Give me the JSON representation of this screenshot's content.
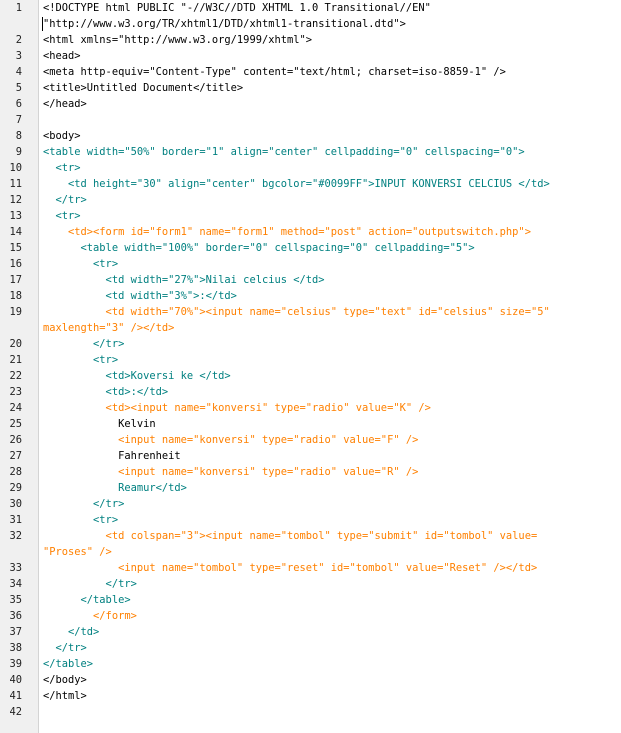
{
  "editor": {
    "colors": {
      "doctype": "#000000",
      "structure_tag": "#000080",
      "table_tag": "#008080",
      "form_tag": "#ff8000",
      "text": "#000000",
      "gutter_bg": "#f0f0f0"
    },
    "rows": [
      {
        "n": "1",
        "t": "<!DOCTYPE html PUBLIC \"-//W3C//DTD XHTML 1.0 Transitional//EN\"",
        "k": "dt"
      },
      {
        "n": "",
        "t": "\"http://www.w3.org/TR/xhtml1/DTD/xhtml1-transitional.dtd\">",
        "k": "dt"
      },
      {
        "n": "2",
        "t": "<html xmlns=\"http://www.w3.org/1999/xhtml\">",
        "k": "tx"
      },
      {
        "n": "3",
        "t": "<head>",
        "k": "tx"
      },
      {
        "n": "4",
        "t": "<meta http-equiv=\"Content-Type\" content=\"text/html; charset=iso-8859-1\" />",
        "k": "tx"
      },
      {
        "n": "5",
        "t": "<title>Untitled Document</title>",
        "k": "tx"
      },
      {
        "n": "6",
        "t": "</head>",
        "k": "tx"
      },
      {
        "n": "7",
        "t": "",
        "k": "tx"
      },
      {
        "n": "8",
        "t": "<body>",
        "k": "tx"
      },
      {
        "n": "9",
        "t": "<table width=\"50%\" border=\"1\" align=\"center\" cellpadding=\"0\" cellspacing=\"0\">",
        "k": "tb"
      },
      {
        "n": "10",
        "t": "  <tr>",
        "k": "tb"
      },
      {
        "n": "11",
        "t": "    <td height=\"30\" align=\"center\" bgcolor=\"#0099FF\">INPUT KONVERSI CELCIUS </td>",
        "k": "tb"
      },
      {
        "n": "12",
        "t": "  </tr>",
        "k": "tb"
      },
      {
        "n": "13",
        "t": "  <tr>",
        "k": "tb"
      },
      {
        "n": "14",
        "t": "    <td><form id=\"form1\" name=\"form1\" method=\"post\" action=\"outputswitch.php\">",
        "k": "fm"
      },
      {
        "n": "15",
        "t": "      <table width=\"100%\" border=\"0\" cellspacing=\"0\" cellpadding=\"5\">",
        "k": "tb"
      },
      {
        "n": "16",
        "t": "        <tr>",
        "k": "tb"
      },
      {
        "n": "17",
        "t": "          <td width=\"27%\">Nilai celcius </td>",
        "k": "tb"
      },
      {
        "n": "18",
        "t": "          <td width=\"3%\">:</td>",
        "k": "tb"
      },
      {
        "n": "19",
        "t": "          <td width=\"70%\"><input name=\"celsius\" type=\"text\" id=\"celsius\" size=\"5\"",
        "k": "fm"
      },
      {
        "n": "",
        "t": "maxlength=\"3\" /></td>",
        "k": "fm"
      },
      {
        "n": "20",
        "t": "        </tr>",
        "k": "tb"
      },
      {
        "n": "21",
        "t": "        <tr>",
        "k": "tb"
      },
      {
        "n": "22",
        "t": "          <td>Koversi ke </td>",
        "k": "tb"
      },
      {
        "n": "23",
        "t": "          <td>:</td>",
        "k": "tb"
      },
      {
        "n": "24",
        "t": "          <td><input name=\"konversi\" type=\"radio\" value=\"K\" />",
        "k": "fm"
      },
      {
        "n": "25",
        "t": "            Kelvin",
        "k": "tx"
      },
      {
        "n": "26",
        "t": "            <input name=\"konversi\" type=\"radio\" value=\"F\" />",
        "k": "fm"
      },
      {
        "n": "27",
        "t": "            Fahrenheit",
        "k": "tx"
      },
      {
        "n": "28",
        "t": "            <input name=\"konversi\" type=\"radio\" value=\"R\" />",
        "k": "fm"
      },
      {
        "n": "29",
        "t": "            Reamur</td>",
        "k": "tb"
      },
      {
        "n": "30",
        "t": "        </tr>",
        "k": "tb"
      },
      {
        "n": "31",
        "t": "        <tr>",
        "k": "tb"
      },
      {
        "n": "32",
        "t": "          <td colspan=\"3\"><input name=\"tombol\" type=\"submit\" id=\"tombol\" value=",
        "k": "fm"
      },
      {
        "n": "",
        "t": "\"Proses\" />",
        "k": "fm"
      },
      {
        "n": "33",
        "t": "            <input name=\"tombol\" type=\"reset\" id=\"tombol\" value=\"Reset\" /></td>",
        "k": "fm"
      },
      {
        "n": "34",
        "t": "          </tr>",
        "k": "tb"
      },
      {
        "n": "35",
        "t": "      </table>",
        "k": "tb"
      },
      {
        "n": "36",
        "t": "        </form>",
        "k": "fm"
      },
      {
        "n": "37",
        "t": "    </td>",
        "k": "tb"
      },
      {
        "n": "38",
        "t": "  </tr>",
        "k": "tb"
      },
      {
        "n": "39",
        "t": "</table>",
        "k": "tb"
      },
      {
        "n": "40",
        "t": "</body>",
        "k": "tx"
      },
      {
        "n": "41",
        "t": "</html>",
        "k": "tx"
      },
      {
        "n": "42",
        "t": "",
        "k": "tx"
      }
    ]
  }
}
